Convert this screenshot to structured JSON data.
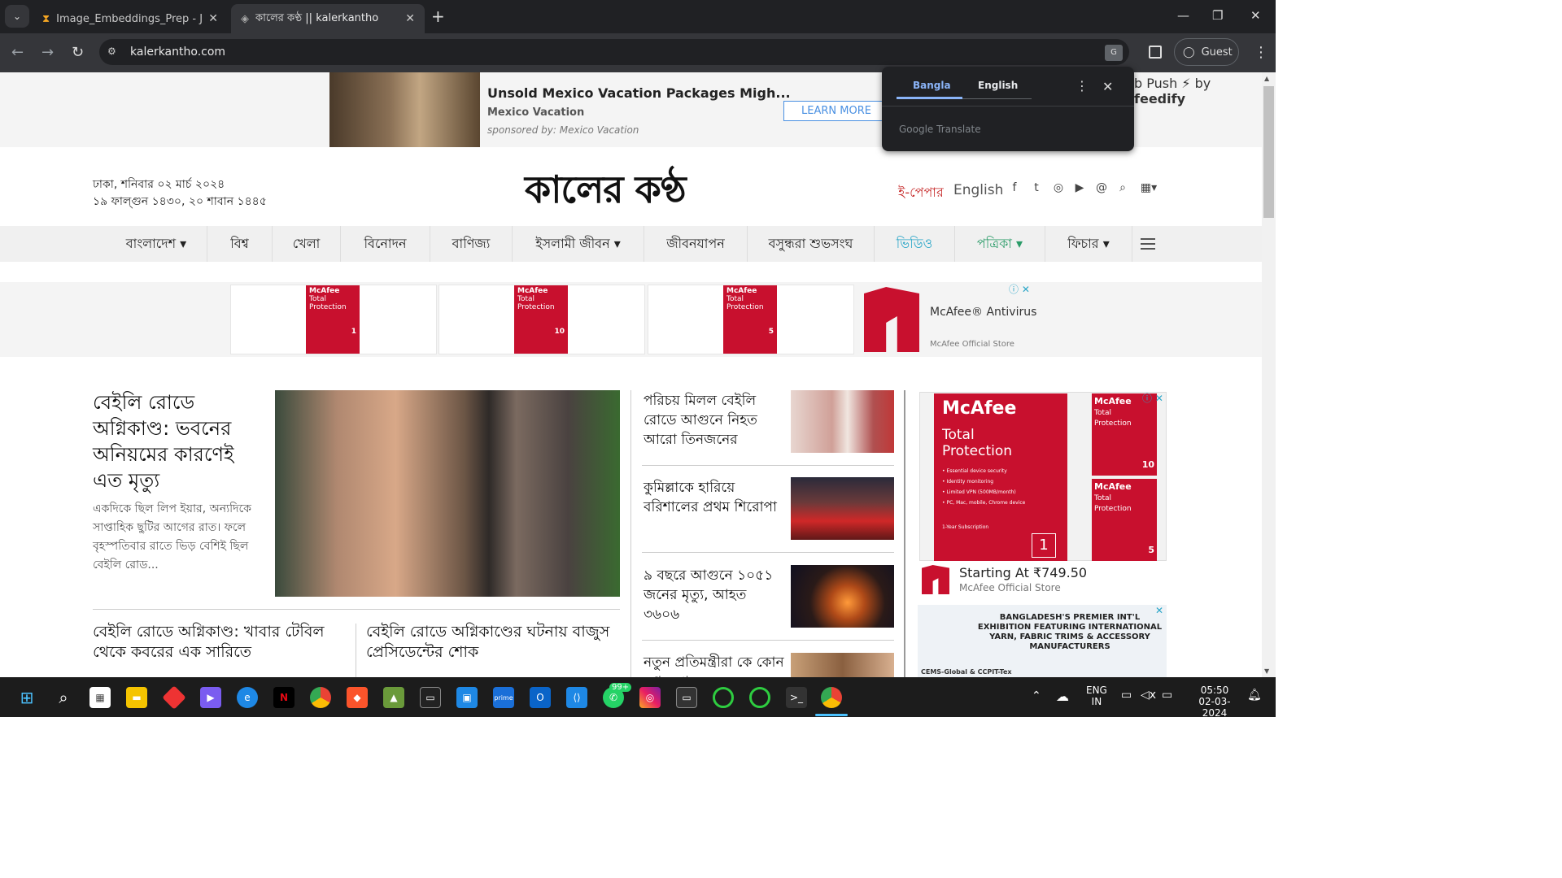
{
  "browser": {
    "tabs": [
      {
        "title": "Image_Embeddings_Prep - Jupy",
        "active": false
      },
      {
        "title": "কালের কণ্ঠ || kalerkantho",
        "active": true
      }
    ],
    "url": "kalerkantho.com",
    "profile": "Guest"
  },
  "translate_popup": {
    "lang_bangla": "Bangla",
    "lang_english": "English",
    "footer": "Google Translate"
  },
  "top_ad": {
    "title": "Unsold Mexico Vacation Packages Migh...",
    "sub": "Mexico Vacation",
    "sponsor": "sponsored by: Mexico Vacation",
    "button": "LEARN MORE",
    "push": "b Push",
    "push_by": "by",
    "push_brand": "feedify"
  },
  "header": {
    "date_line1": "ঢাকা, শনিবার ০২ মার্চ ২০২৪",
    "date_line2": "১৯ ফাল্গুন ১৪৩০, ২০ শাবান ১৪৪৫",
    "logo": "কালের কণ্ঠ",
    "epaper": "ই-পেপার",
    "english": "English"
  },
  "nav": [
    "বাংলাদেশ ▾",
    "বিশ্ব",
    "খেলা",
    "বিনোদন",
    "বাণিজ্য",
    "ইসলামী জীবন ▾",
    "জীবনযাপন",
    "বসুন্ধরা শুভসংঘ",
    "ভিডিও",
    "পত্রিকা ▾",
    "ফিচার ▾"
  ],
  "mcafee_strip": {
    "brand": "McAfee",
    "line": "Total Protection",
    "n1": "1",
    "n2": "10",
    "n3": "5",
    "name": "McAfee® Antivirus",
    "store": "McAfee Official Store"
  },
  "lead": {
    "title": "বেইলি রোডে অগ্নিকাণ্ড: ভবনের অনিয়মের কারণেই এত মৃত্যু",
    "summary": "একদিকে ছিল লিপ ইয়ার, অন্যদিকে সাপ্তাহিক ছুটির আগের রাত। ফলে বৃহস্পতিবার রাতে ভিড় বেশিই ছিল বেইলি রোড..."
  },
  "secondary": [
    {
      "title": "বেইলি রোডে অগ্নিকাণ্ড: খাবার টেবিল থেকে কবরের এক সারিতে"
    },
    {
      "title": "বেইলি রোডে অগ্নিকাণ্ডের ঘটনায় বাজুস প্রেসিডেন্টের শোক"
    }
  ],
  "side_news": [
    {
      "title": "পরিচয় মিলল বেইলি রোডে আগুনে নিহত আরো তিনজনের"
    },
    {
      "title": "কুমিল্লাকে হারিয়ে বরিশালের প্রথম শিরোপা"
    },
    {
      "title": "৯ বছরে আগুনে ১০৫১ জনের মৃত্যু, আহত ৩৬০৬"
    },
    {
      "title": "নতুন প্রতিমন্ত্রীরা কে কোন দপ্তর পেলেন"
    }
  ],
  "right_ad": {
    "brand": "McAfee",
    "line1": "Total",
    "line2": "Protection",
    "features": [
      "• Essential device security",
      "• Identity monitoring",
      "• Limited VPN (500MB/month)",
      "• PC, Mac, mobile, Chrome device"
    ],
    "sub": "1-Year Subscription",
    "num": "1",
    "num2": "10",
    "num3": "5",
    "price": "Starting At ₹749.50",
    "store": "McAfee Official Store"
  },
  "exhibit_ad": {
    "text": "BANGLADESH'S PREMIER INT'L EXHIBITION FEATURING INTERNATIONAL YARN, FABRIC TRIMS & ACCESSORY MANUFACTURERS",
    "org": "CEMS-Global & CCPIT-Tex"
  },
  "taskbar": {
    "lang": "ENG",
    "region": "IN",
    "time": "05:50",
    "date": "02-03-2024",
    "badge": "99+"
  }
}
